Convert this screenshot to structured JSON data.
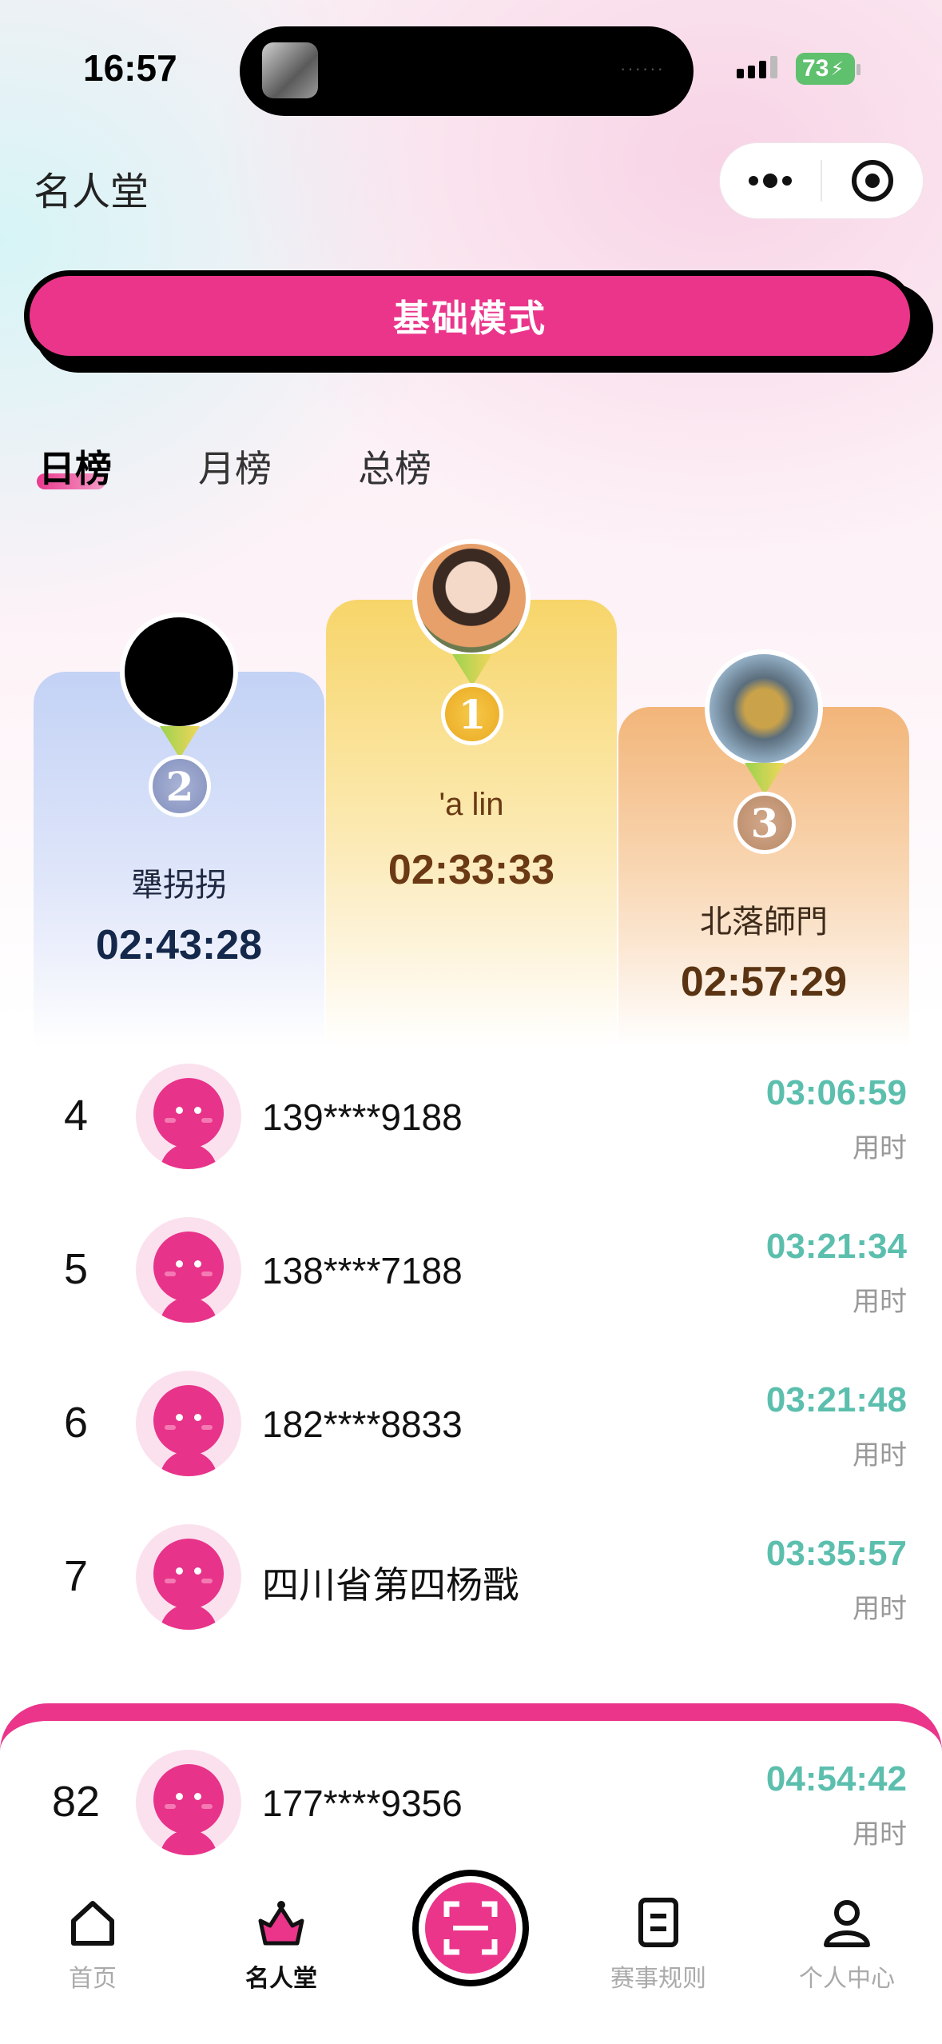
{
  "status_bar": {
    "time": "16:57",
    "battery": "73",
    "island_dots": "······"
  },
  "nav": {
    "title": "名人堂"
  },
  "mode_button": {
    "label": "基础模式"
  },
  "tabs": [
    {
      "label": "日榜",
      "active": true
    },
    {
      "label": "月榜",
      "active": false
    },
    {
      "label": "总榜",
      "active": false
    }
  ],
  "podium": {
    "first": {
      "rank": "1",
      "name": "'a lin",
      "time": "02:33:33"
    },
    "second": {
      "rank": "2",
      "name": "犟拐拐",
      "time": "02:43:28"
    },
    "third": {
      "rank": "3",
      "name": "北落師門",
      "time": "02:57:29"
    }
  },
  "list": [
    {
      "rank": "4",
      "name": "139****9188",
      "time": "03:06:59",
      "label": "用时"
    },
    {
      "rank": "5",
      "name": "138****7188",
      "time": "03:21:34",
      "label": "用时"
    },
    {
      "rank": "6",
      "name": "182****8833",
      "time": "03:21:48",
      "label": "用时"
    },
    {
      "rank": "7",
      "name": "四川省第四杨戬",
      "time": "03:35:57",
      "label": "用时"
    }
  ],
  "my_rank": {
    "rank": "82",
    "name": "177****9356",
    "time": "04:54:42",
    "label": "用时"
  },
  "tab_bar": [
    {
      "label": "首页",
      "icon": "home-icon",
      "active": false
    },
    {
      "label": "名人堂",
      "icon": "trophy-icon",
      "active": true
    },
    {
      "label": "",
      "icon": "scan-icon",
      "active": false
    },
    {
      "label": "赛事规则",
      "icon": "rules-icon",
      "active": false
    },
    {
      "label": "个人中心",
      "icon": "person-icon",
      "active": false
    }
  ],
  "colors": {
    "accent": "#ea358b",
    "time_green": "#5cbfae",
    "gold_text": "#6b3a14",
    "silver_text": "#14284b"
  }
}
